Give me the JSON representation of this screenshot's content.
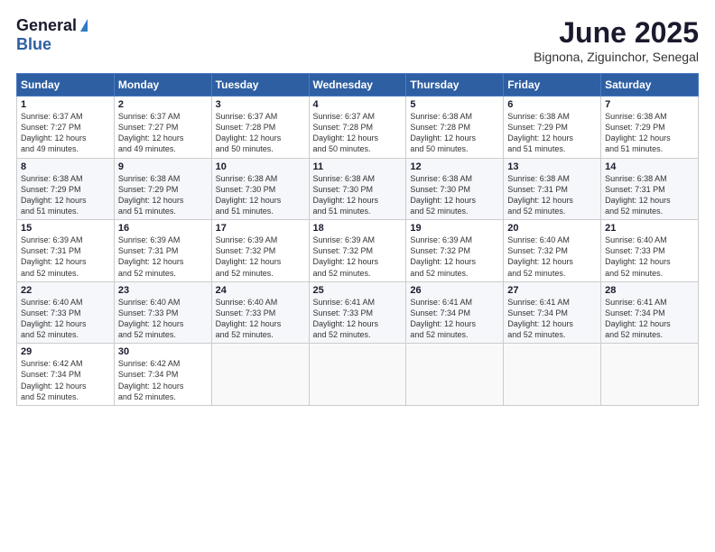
{
  "logo": {
    "general": "General",
    "blue": "Blue"
  },
  "title": "June 2025",
  "subtitle": "Bignona, Ziguinchor, Senegal",
  "days_of_week": [
    "Sunday",
    "Monday",
    "Tuesday",
    "Wednesday",
    "Thursday",
    "Friday",
    "Saturday"
  ],
  "weeks": [
    [
      {
        "day": "1",
        "info": "Sunrise: 6:37 AM\nSunset: 7:27 PM\nDaylight: 12 hours\nand 49 minutes."
      },
      {
        "day": "2",
        "info": "Sunrise: 6:37 AM\nSunset: 7:27 PM\nDaylight: 12 hours\nand 49 minutes."
      },
      {
        "day": "3",
        "info": "Sunrise: 6:37 AM\nSunset: 7:28 PM\nDaylight: 12 hours\nand 50 minutes."
      },
      {
        "day": "4",
        "info": "Sunrise: 6:37 AM\nSunset: 7:28 PM\nDaylight: 12 hours\nand 50 minutes."
      },
      {
        "day": "5",
        "info": "Sunrise: 6:38 AM\nSunset: 7:28 PM\nDaylight: 12 hours\nand 50 minutes."
      },
      {
        "day": "6",
        "info": "Sunrise: 6:38 AM\nSunset: 7:29 PM\nDaylight: 12 hours\nand 51 minutes."
      },
      {
        "day": "7",
        "info": "Sunrise: 6:38 AM\nSunset: 7:29 PM\nDaylight: 12 hours\nand 51 minutes."
      }
    ],
    [
      {
        "day": "8",
        "info": "Sunrise: 6:38 AM\nSunset: 7:29 PM\nDaylight: 12 hours\nand 51 minutes."
      },
      {
        "day": "9",
        "info": "Sunrise: 6:38 AM\nSunset: 7:29 PM\nDaylight: 12 hours\nand 51 minutes."
      },
      {
        "day": "10",
        "info": "Sunrise: 6:38 AM\nSunset: 7:30 PM\nDaylight: 12 hours\nand 51 minutes."
      },
      {
        "day": "11",
        "info": "Sunrise: 6:38 AM\nSunset: 7:30 PM\nDaylight: 12 hours\nand 51 minutes."
      },
      {
        "day": "12",
        "info": "Sunrise: 6:38 AM\nSunset: 7:30 PM\nDaylight: 12 hours\nand 52 minutes."
      },
      {
        "day": "13",
        "info": "Sunrise: 6:38 AM\nSunset: 7:31 PM\nDaylight: 12 hours\nand 52 minutes."
      },
      {
        "day": "14",
        "info": "Sunrise: 6:38 AM\nSunset: 7:31 PM\nDaylight: 12 hours\nand 52 minutes."
      }
    ],
    [
      {
        "day": "15",
        "info": "Sunrise: 6:39 AM\nSunset: 7:31 PM\nDaylight: 12 hours\nand 52 minutes."
      },
      {
        "day": "16",
        "info": "Sunrise: 6:39 AM\nSunset: 7:31 PM\nDaylight: 12 hours\nand 52 minutes."
      },
      {
        "day": "17",
        "info": "Sunrise: 6:39 AM\nSunset: 7:32 PM\nDaylight: 12 hours\nand 52 minutes."
      },
      {
        "day": "18",
        "info": "Sunrise: 6:39 AM\nSunset: 7:32 PM\nDaylight: 12 hours\nand 52 minutes."
      },
      {
        "day": "19",
        "info": "Sunrise: 6:39 AM\nSunset: 7:32 PM\nDaylight: 12 hours\nand 52 minutes."
      },
      {
        "day": "20",
        "info": "Sunrise: 6:40 AM\nSunset: 7:32 PM\nDaylight: 12 hours\nand 52 minutes."
      },
      {
        "day": "21",
        "info": "Sunrise: 6:40 AM\nSunset: 7:33 PM\nDaylight: 12 hours\nand 52 minutes."
      }
    ],
    [
      {
        "day": "22",
        "info": "Sunrise: 6:40 AM\nSunset: 7:33 PM\nDaylight: 12 hours\nand 52 minutes."
      },
      {
        "day": "23",
        "info": "Sunrise: 6:40 AM\nSunset: 7:33 PM\nDaylight: 12 hours\nand 52 minutes."
      },
      {
        "day": "24",
        "info": "Sunrise: 6:40 AM\nSunset: 7:33 PM\nDaylight: 12 hours\nand 52 minutes."
      },
      {
        "day": "25",
        "info": "Sunrise: 6:41 AM\nSunset: 7:33 PM\nDaylight: 12 hours\nand 52 minutes."
      },
      {
        "day": "26",
        "info": "Sunrise: 6:41 AM\nSunset: 7:34 PM\nDaylight: 12 hours\nand 52 minutes."
      },
      {
        "day": "27",
        "info": "Sunrise: 6:41 AM\nSunset: 7:34 PM\nDaylight: 12 hours\nand 52 minutes."
      },
      {
        "day": "28",
        "info": "Sunrise: 6:41 AM\nSunset: 7:34 PM\nDaylight: 12 hours\nand 52 minutes."
      }
    ],
    [
      {
        "day": "29",
        "info": "Sunrise: 6:42 AM\nSunset: 7:34 PM\nDaylight: 12 hours\nand 52 minutes."
      },
      {
        "day": "30",
        "info": "Sunrise: 6:42 AM\nSunset: 7:34 PM\nDaylight: 12 hours\nand 52 minutes."
      },
      null,
      null,
      null,
      null,
      null
    ]
  ]
}
